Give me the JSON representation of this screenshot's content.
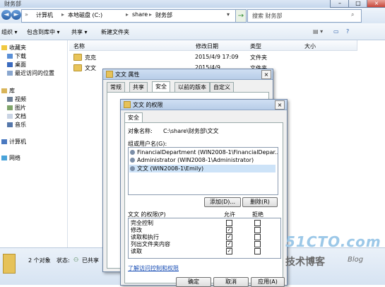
{
  "window": {
    "title": "财务部",
    "controls": [
      "–",
      "□",
      "×"
    ]
  },
  "address": {
    "back": "◄",
    "forward": "►",
    "path": [
      "计算机",
      "本地磁盘 (C:)",
      "share",
      "财务部"
    ],
    "refresh": "→",
    "search_placeholder": "搜索 财务部"
  },
  "toolbar": {
    "organize": "组织 ▾",
    "include": "包含到库中 ▾",
    "share": "共享 ▾",
    "new_folder": "新建文件夹"
  },
  "nav": {
    "favorites": "收藏夹",
    "downloads": "下载",
    "desktop": "桌面",
    "recent": "最近访问的位置",
    "libraries": "库",
    "videos": "视频",
    "pictures": "图片",
    "documents": "文档",
    "music": "音乐",
    "computer": "计算机",
    "network": "网络"
  },
  "columns": {
    "name": "名称",
    "date": "修改日期",
    "type": "类型",
    "size": "大小"
  },
  "files": [
    {
      "name": "克克",
      "date": "2015/4/9 17:09",
      "type": "文件夹"
    },
    {
      "name": "文文",
      "date": "2015/4/9 ...",
      "type": "文件夹"
    }
  ],
  "status": {
    "count": "2 个对象",
    "state_label": "状态:",
    "state_value": "已共享"
  },
  "props_dialog": {
    "title": "文文 属性",
    "tabs": [
      "常规",
      "共享",
      "安全",
      "以前的版本",
      "自定义"
    ]
  },
  "perm_dialog": {
    "title": "文文 的权限",
    "tab": "安全",
    "object_label": "对象名称:",
    "object_value": "C:\\share\\财务部\\文文",
    "group_label": "组或用户名(G):",
    "users": [
      "FinancialDepartment (WIN2008-1\\FinancialDepar...",
      "Administrator (WIN2008-1\\Administrator)",
      "文文 (WIN2008-1\\Emily)"
    ],
    "add_button": "添加(D)...",
    "remove_button": "删除(R)",
    "perm_label": "文文 的权限(P)",
    "allow": "允许",
    "deny": "拒绝",
    "permissions": [
      {
        "name": "完全控制",
        "allow": false,
        "deny": false
      },
      {
        "name": "修改",
        "allow": true,
        "deny": false
      },
      {
        "name": "读取和执行",
        "allow": true,
        "deny": false
      },
      {
        "name": "列出文件夹内容",
        "allow": true,
        "deny": false
      },
      {
        "name": "读取",
        "allow": true,
        "deny": false
      }
    ],
    "learn_link": "了解访问控制和权限",
    "ok": "确定",
    "cancel": "取消",
    "apply": "应用(A)"
  },
  "watermark": {
    "site": "51CTO.com",
    "sub": "技术博客",
    "blog": "Blog"
  }
}
